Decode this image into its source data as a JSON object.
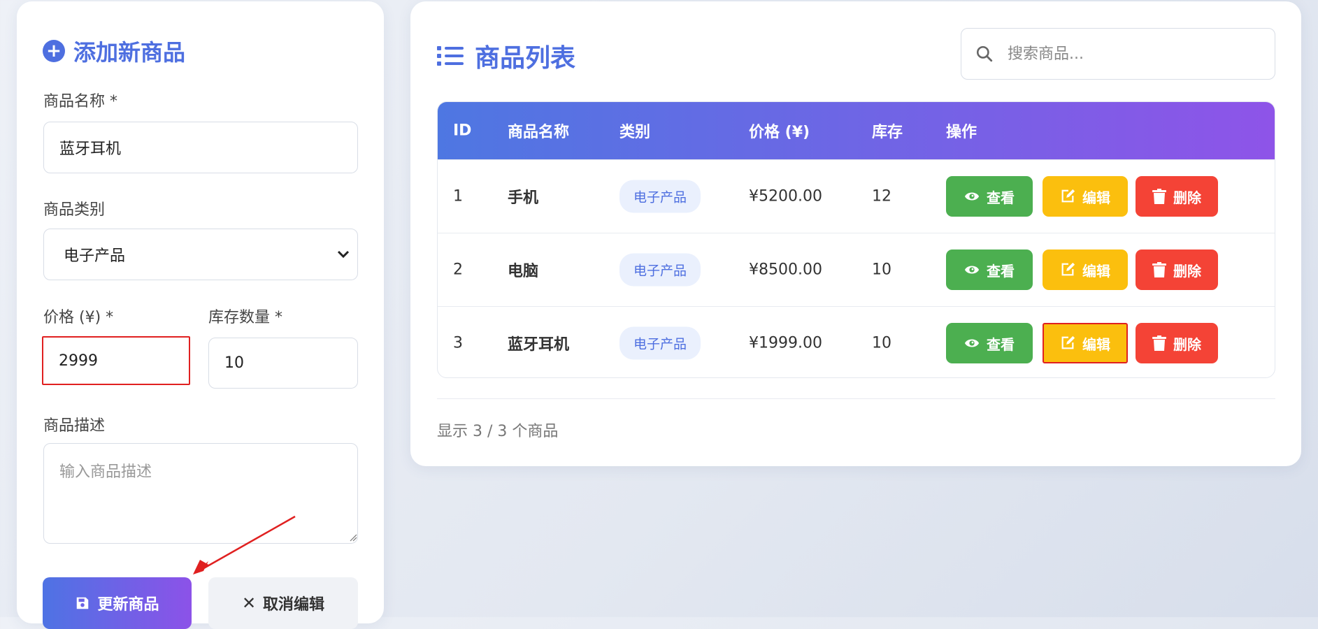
{
  "form": {
    "title": "添加新商品",
    "name_label": "商品名称 *",
    "name_value": "蓝牙耳机",
    "category_label": "商品类别",
    "category_value": "电子产品",
    "price_label": "价格 (¥) *",
    "price_value": "2999",
    "stock_label": "库存数量 *",
    "stock_value": "10",
    "desc_label": "商品描述",
    "desc_placeholder": "输入商品描述",
    "update_button": "更新商品",
    "cancel_button": "取消编辑"
  },
  "list": {
    "title": "商品列表",
    "search_placeholder": "搜索商品...",
    "headers": [
      "ID",
      "商品名称",
      "类别",
      "价格 (¥)",
      "库存",
      "操作"
    ],
    "rows": [
      {
        "id": "1",
        "name": "手机",
        "category": "电子产品",
        "price": "¥5200.00",
        "stock": "12"
      },
      {
        "id": "2",
        "name": "电脑",
        "category": "电子产品",
        "price": "¥8500.00",
        "stock": "10"
      },
      {
        "id": "3",
        "name": "蓝牙耳机",
        "category": "电子产品",
        "price": "¥1999.00",
        "stock": "10"
      }
    ],
    "actions": {
      "view": "查看",
      "edit": "编辑",
      "delete": "删除"
    },
    "footer": "显示 3 / 3 个商品"
  },
  "colors": {
    "accent": "#4e6fe0",
    "view": "#4caf50",
    "edit": "#fbbf0e",
    "delete": "#f44336",
    "annotation": "#e02020"
  },
  "icons": {
    "form_title": "plus-circle-icon",
    "list_title": "list-icon",
    "search": "search-icon",
    "view": "eye-icon",
    "edit": "edit-icon",
    "delete": "trash-icon",
    "update": "save-icon",
    "cancel": "close-icon"
  }
}
